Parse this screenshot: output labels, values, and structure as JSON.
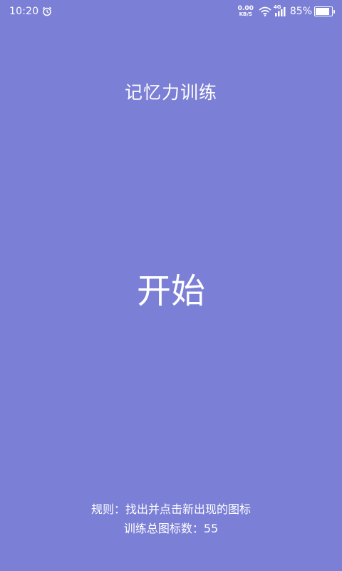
{
  "status_bar": {
    "time": "10:20",
    "net_speed_value": "0.00",
    "net_speed_unit": "KB/S",
    "network_type": "4G",
    "battery_percent": "85%",
    "battery_level": 0.85,
    "icons": [
      "alarm-icon",
      "wifi-icon",
      "signal-icon",
      "battery-icon"
    ]
  },
  "header": {
    "title": "记忆力训练"
  },
  "main": {
    "start_label": "开始"
  },
  "footer": {
    "rules_text": "规则：找出并点击新出现的图标",
    "total_label": "训练总图标数：",
    "total_count": "55"
  },
  "colors": {
    "background": "#7b7fd6",
    "text": "#ffffff"
  }
}
